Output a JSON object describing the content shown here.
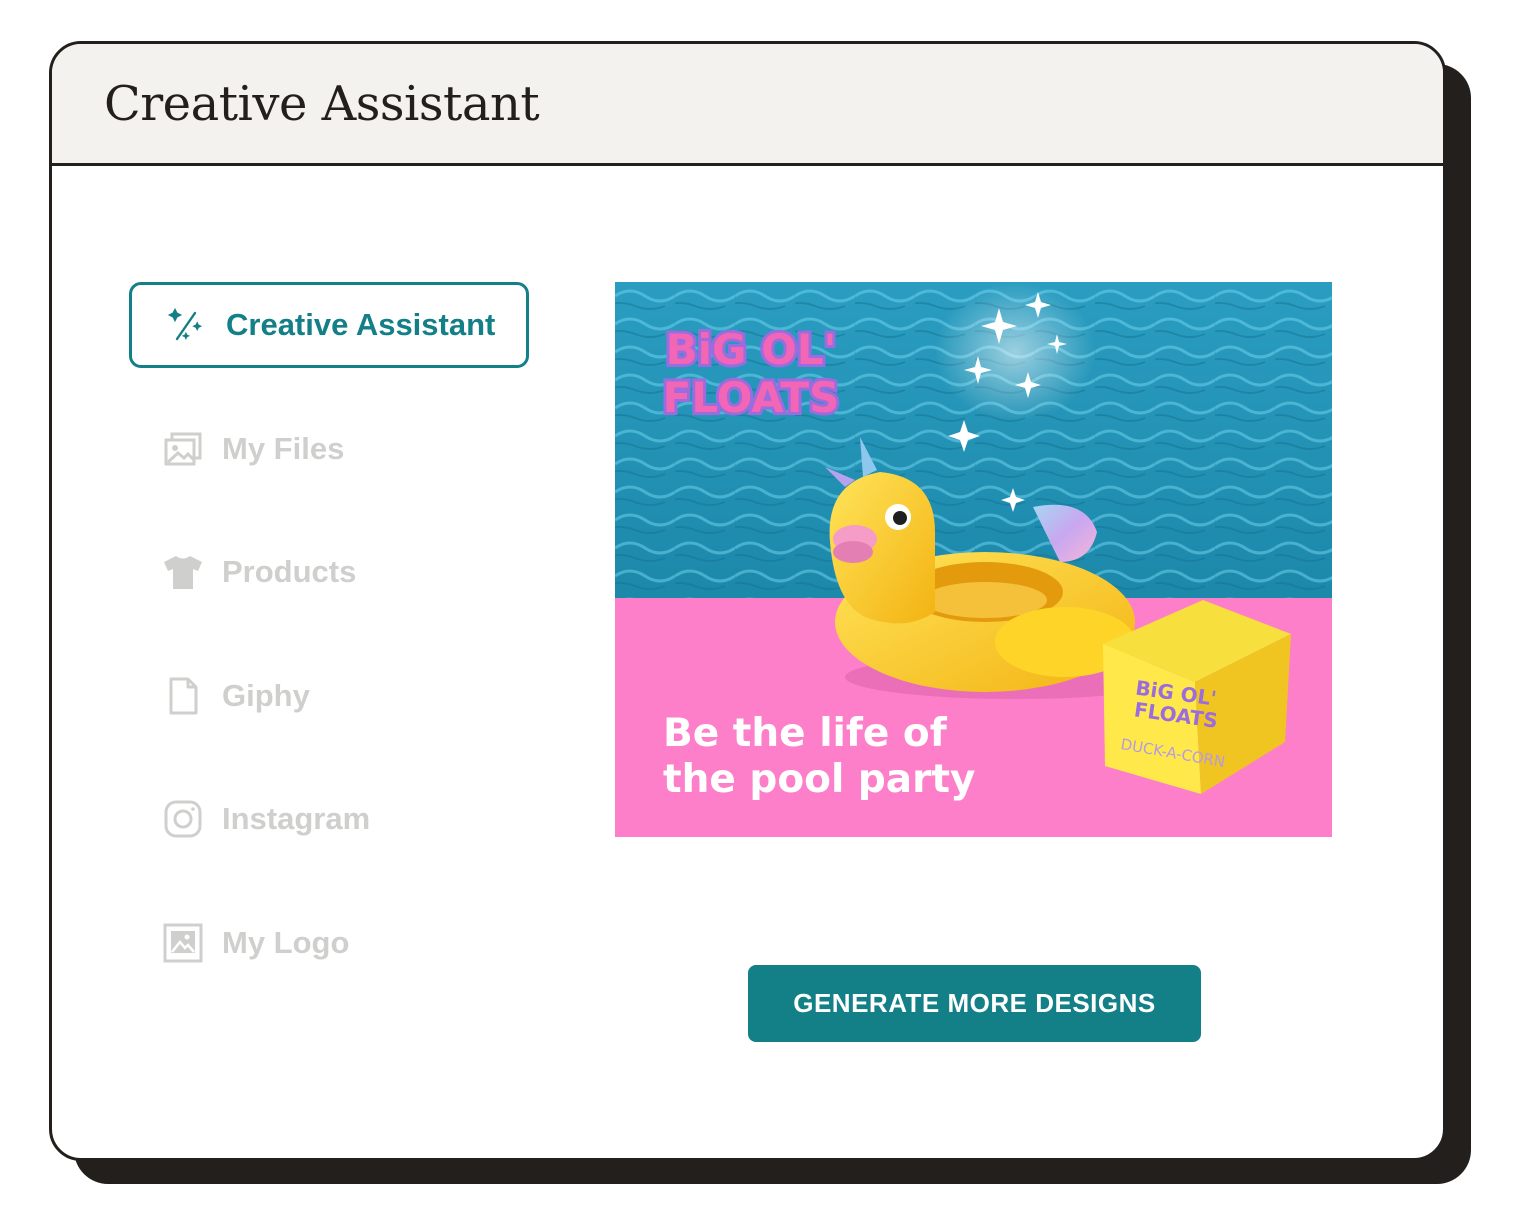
{
  "window": {
    "title": "Creative Assistant"
  },
  "sidebar": {
    "active": {
      "label": "Creative Assistant",
      "icon": "magic-wand-icon"
    },
    "items": [
      {
        "label": "My Files",
        "icon": "images-icon"
      },
      {
        "label": "Products",
        "icon": "tshirt-icon"
      },
      {
        "label": "Giphy",
        "icon": "document-icon"
      },
      {
        "label": "Instagram",
        "icon": "instagram-icon"
      },
      {
        "label": "My Logo",
        "icon": "image-icon"
      }
    ]
  },
  "preview": {
    "brand": [
      "BiG OL'",
      "FLOATS"
    ],
    "headline_lines": [
      "Be the life of",
      "the pool party"
    ],
    "box_brand": [
      "BiG OL'",
      "FLOATS"
    ],
    "box_product": "DUCK-A-CORN"
  },
  "actions": {
    "generate_label": "GENERATE MORE DESIGNS"
  },
  "colors": {
    "accent": "#137f86",
    "ink": "#231f1c",
    "muted": "#cfcfcd",
    "pool": "#2f9fc0",
    "pink": "#fd7fc9"
  }
}
